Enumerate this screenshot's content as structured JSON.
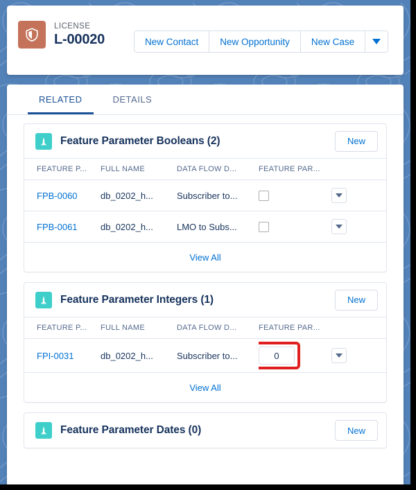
{
  "header": {
    "record_type_label": "LICENSE",
    "record_name": "L-00020",
    "record_icon": "shield-icon",
    "actions": [
      {
        "label": "New Contact"
      },
      {
        "label": "New Opportunity"
      },
      {
        "label": "New Case"
      }
    ],
    "more_actions_icon": "chevron-down-icon"
  },
  "tabs": [
    {
      "label": "RELATED",
      "active": true
    },
    {
      "label": "DETAILS",
      "active": false
    }
  ],
  "columns": [
    "FEATURE P...",
    "FULL NAME",
    "DATA FLOW D...",
    "FEATURE PAR..."
  ],
  "cards": [
    {
      "icon": "feature-parameter-icon",
      "title": "Feature Parameter Booleans (2)",
      "new_label": "New",
      "has_table": true,
      "value_type": "checkbox",
      "rows": [
        {
          "name": "FPB-0060",
          "full_name": "db_0202_h...",
          "data_flow": "Subscriber to...",
          "value": "",
          "checked": false,
          "menu_icon": "chevron-down-icon"
        },
        {
          "name": "FPB-0061",
          "full_name": "db_0202_h...",
          "data_flow": "LMO to Subs...",
          "value": "",
          "checked": false,
          "menu_icon": "chevron-down-icon"
        }
      ],
      "view_all_label": "View All"
    },
    {
      "icon": "feature-parameter-icon",
      "title": "Feature Parameter Integers (1)",
      "new_label": "New",
      "has_table": true,
      "value_type": "number",
      "rows": [
        {
          "name": "FPI-0031",
          "full_name": "db_0202_h...",
          "data_flow": "Subscriber to...",
          "value": "0",
          "highlighted": true,
          "menu_icon": "chevron-down-icon"
        }
      ],
      "view_all_label": "View All"
    },
    {
      "icon": "feature-parameter-icon",
      "title": "Feature Parameter Dates (0)",
      "new_label": "New",
      "has_table": false,
      "rows": [],
      "view_all_label": ""
    }
  ],
  "colors": {
    "link": "#0070d2",
    "record_icon_bg": "#c4735a",
    "card_icon_bg": "#3ecfcb",
    "tab_active": "#1b5297",
    "annotation": "#e02020",
    "background": "#5382b9"
  }
}
